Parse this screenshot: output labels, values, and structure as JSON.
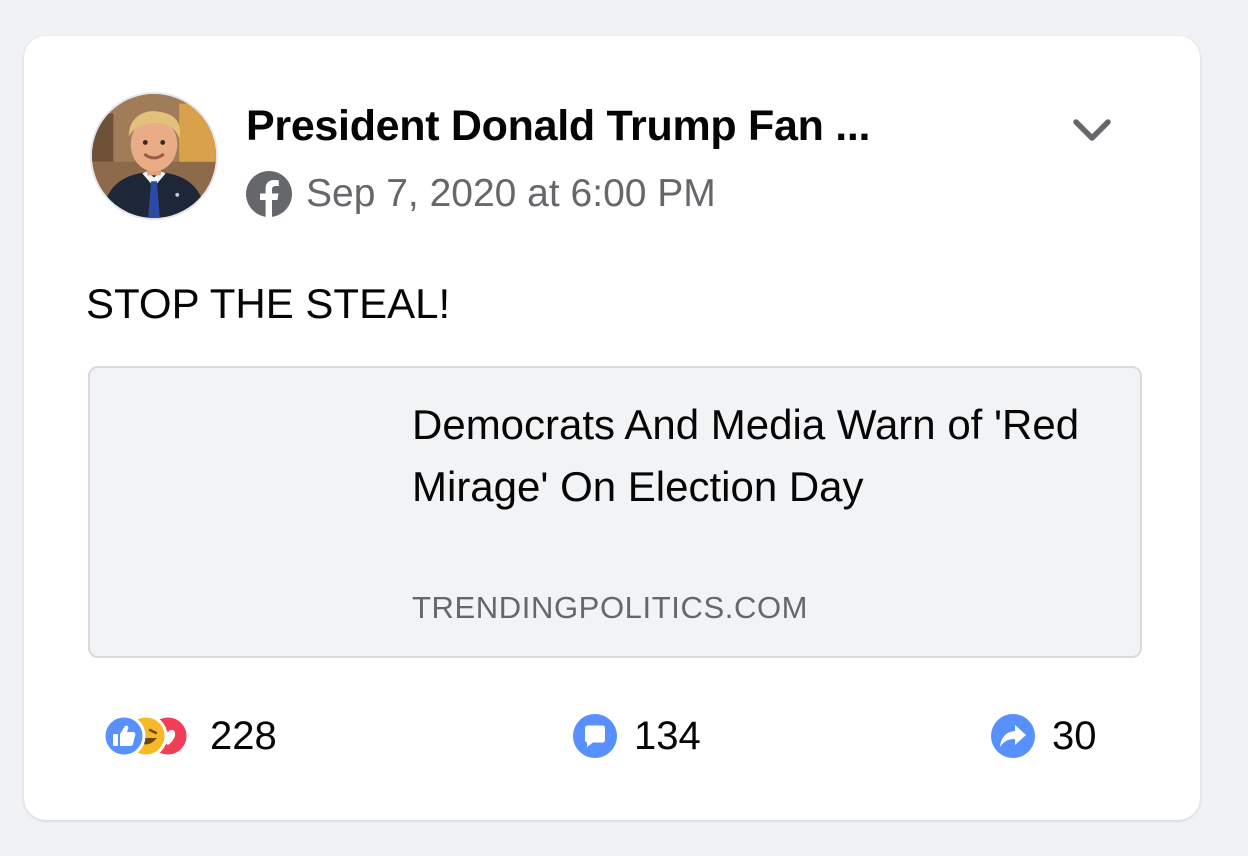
{
  "post": {
    "page_name": "President Donald Trump Fan ...",
    "timestamp": "Sep 7, 2020 at 6:00 PM",
    "text": "STOP THE STEAL!"
  },
  "link": {
    "title": "Democrats And Media Warn of 'Red Mirage' On Election Day",
    "domain": "TRENDINGPOLITICS.COM"
  },
  "stats": {
    "reactions": "228",
    "comments": "134",
    "shares": "30"
  },
  "icons": {
    "platform": "facebook-icon",
    "menu": "chevron-down-icon",
    "reactions": [
      "like-reaction-icon",
      "haha-reaction-icon",
      "love-reaction-icon"
    ],
    "comments": "comment-icon",
    "shares": "share-icon"
  },
  "colors": {
    "background": "#f0f2f5",
    "card": "#ffffff",
    "secondary_text": "#65676b",
    "brand_blue": "#1877f2",
    "reaction_blue": "#5890ff",
    "haha_yellow": "#f7b928",
    "love_red": "#f33e58"
  }
}
